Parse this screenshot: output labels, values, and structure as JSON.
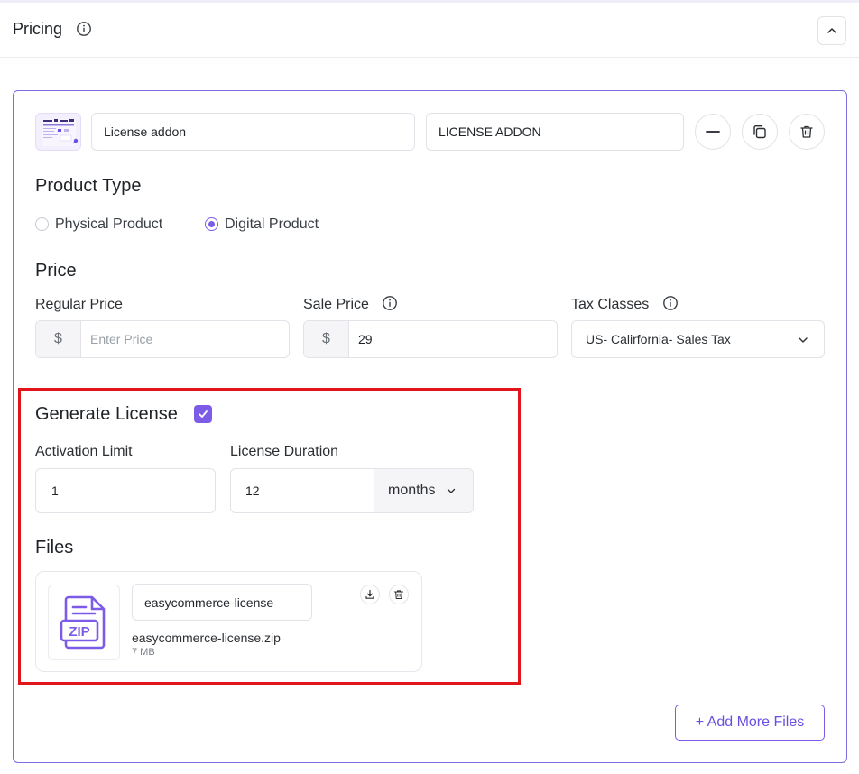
{
  "section": {
    "title": "Pricing"
  },
  "product": {
    "name_value": "License addon",
    "slug_value": "LICENSE ADDON"
  },
  "product_type": {
    "heading": "Product Type",
    "options": [
      "Physical Product",
      "Digital Product"
    ],
    "selected": "Digital Product"
  },
  "price": {
    "heading": "Price",
    "regular_label": "Regular Price",
    "regular_placeholder": "Enter Price",
    "sale_label": "Sale Price",
    "sale_value": "29",
    "currency_symbol": "$",
    "tax_label": "Tax Classes",
    "tax_value": "US- Calirfornia- Sales Tax"
  },
  "license": {
    "heading": "Generate License",
    "checked": true,
    "activation_label": "Activation Limit",
    "activation_value": "1",
    "duration_label": "License Duration",
    "duration_value": "12",
    "duration_unit": "months"
  },
  "files": {
    "heading": "Files",
    "items": [
      {
        "name_value": "easycommerce-license",
        "filename": "easycommerce-license.zip",
        "size": "7 MB",
        "icon_text": "ZIP"
      }
    ],
    "add_button": "+ Add More Files"
  },
  "colors": {
    "accent": "#7c5ce6",
    "highlight": "#e2141c",
    "border": "#e2e2e8"
  }
}
